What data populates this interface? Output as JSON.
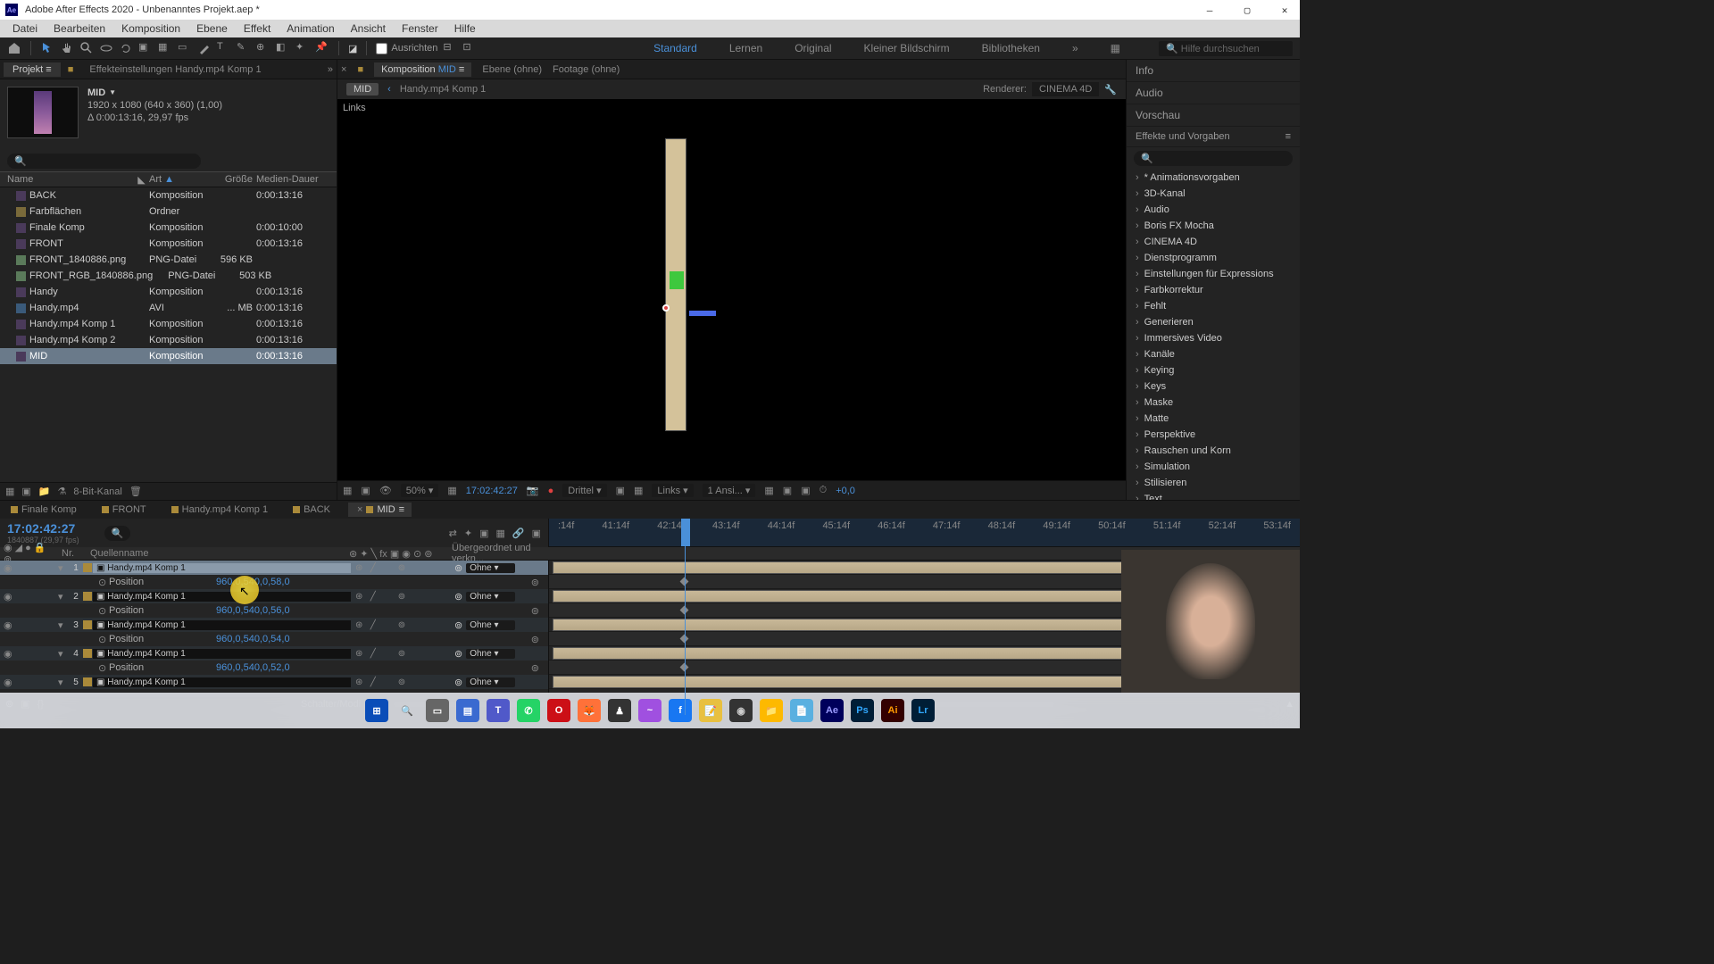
{
  "titlebar": {
    "app": "Adobe After Effects 2020",
    "file": "Unbenanntes Projekt.aep *"
  },
  "menu": [
    "Datei",
    "Bearbeiten",
    "Komposition",
    "Ebene",
    "Effekt",
    "Animation",
    "Ansicht",
    "Fenster",
    "Hilfe"
  ],
  "toolbar": {
    "ausrichten": "Ausrichten"
  },
  "workspaces": {
    "items": [
      "Standard",
      "Lernen",
      "Original",
      "Kleiner Bildschirm",
      "Bibliotheken"
    ],
    "active": "Standard",
    "search_ph": "Hilfe durchsuchen"
  },
  "project": {
    "tabs": {
      "projekt": "Projekt",
      "effekteinstellungen": "Effekteinstellungen Handy.mp4 Komp 1"
    },
    "preview": {
      "name": "MID",
      "dims": "1920 x 1080 (640 x 360) (1,00)",
      "dur": "Δ 0:00:13:16, 29,97 fps"
    },
    "headers": {
      "name": "Name",
      "art": "Art",
      "size": "Größe",
      "dur": "Medien-Dauer"
    },
    "items": [
      {
        "name": "BACK",
        "icon": "comp",
        "dot": "y",
        "art": "Komposition",
        "size": "",
        "dur": "0:00:13:16"
      },
      {
        "name": "Farbflächen",
        "icon": "folder",
        "dot": "n",
        "art": "Ordner",
        "size": "",
        "dur": ""
      },
      {
        "name": "Finale Komp",
        "icon": "comp",
        "dot": "y",
        "art": "Komposition",
        "size": "",
        "dur": "0:00:10:00"
      },
      {
        "name": "FRONT",
        "icon": "comp",
        "dot": "y",
        "art": "Komposition",
        "size": "",
        "dur": "0:00:13:16"
      },
      {
        "name": "FRONT_1840886.png",
        "icon": "png",
        "dot": "y",
        "art": "PNG-Datei",
        "size": "596 KB",
        "dur": ""
      },
      {
        "name": "FRONT_RGB_1840886.png",
        "icon": "png",
        "dot": "y",
        "art": "PNG-Datei",
        "size": "503 KB",
        "dur": ""
      },
      {
        "name": "Handy",
        "icon": "comp",
        "dot": "y",
        "art": "Komposition",
        "size": "",
        "dur": "0:00:13:16"
      },
      {
        "name": "Handy.mp4",
        "icon": "avi",
        "dot": "n",
        "art": "AVI",
        "size": "... MB",
        "dur": "0:00:13:16"
      },
      {
        "name": "Handy.mp4 Komp 1",
        "icon": "comp",
        "dot": "y",
        "art": "Komposition",
        "size": "",
        "dur": "0:00:13:16"
      },
      {
        "name": "Handy.mp4 Komp 2",
        "icon": "comp",
        "dot": "y",
        "art": "Komposition",
        "size": "",
        "dur": "0:00:13:16"
      },
      {
        "name": "MID",
        "icon": "comp",
        "dot": "y",
        "art": "Komposition",
        "size": "",
        "dur": "0:00:13:16",
        "sel": true
      }
    ],
    "footer_bpc": "8-Bit-Kanal"
  },
  "comp": {
    "tabs": {
      "komp_prefix": "Komposition",
      "komp": "MID",
      "ebene": "Ebene (ohne)",
      "footage": "Footage (ohne)"
    },
    "crumb": {
      "active": "MID",
      "back_icon": "‹",
      "parent": "Handy.mp4 Komp 1",
      "renderer_lbl": "Renderer:",
      "renderer_val": "CINEMA 4D"
    },
    "viewer_label": "Links",
    "footer": {
      "zoom": "50%",
      "tc": "17:02:42:27",
      "res": "Drittel",
      "view": "Links",
      "views": "1 Ansi...",
      "exposure": "+0,0"
    }
  },
  "right": {
    "sections": [
      "Info",
      "Audio",
      "Vorschau"
    ],
    "effects_title": "Effekte und Vorgaben",
    "categories": [
      "* Animationsvorgaben",
      "3D-Kanal",
      "Audio",
      "Boris FX Mocha",
      "CINEMA 4D",
      "Dienstprogramm",
      "Einstellungen für Expressions",
      "Farbkorrektur",
      "Fehlt",
      "Generieren",
      "Immersives Video",
      "Kanäle",
      "Keying",
      "Keys",
      "Maske",
      "Matte",
      "Perspektive",
      "Rauschen und Korn",
      "Simulation",
      "Stilisieren",
      "Text"
    ]
  },
  "timeline": {
    "tabs": [
      "Finale Komp",
      "FRONT",
      "Handy.mp4 Komp 1",
      "BACK",
      "MID"
    ],
    "active_tab": "MID",
    "tc": "17:02:42:27",
    "tc_sub": "1840887 (29,97 fps)",
    "cols": {
      "nr": "Nr.",
      "src": "Quellenname",
      "parent": "Übergeordnet und verkn..."
    },
    "ruler": [
      ":14f",
      "41:14f",
      "42:14f",
      "43:14f",
      "44:14f",
      "45:14f",
      "46:14f",
      "47:14f",
      "48:14f",
      "49:14f",
      "50:14f",
      "51:14f",
      "52:14f",
      "53:14f"
    ],
    "layers": [
      {
        "nr": "1",
        "name": "Handy.mp4 Komp 1",
        "parent": "Ohne",
        "prop": "Position",
        "val": "960,0,540,0,58,0",
        "sel": true
      },
      {
        "nr": "2",
        "name": "Handy.mp4 Komp 1",
        "parent": "Ohne",
        "prop": "Position",
        "val": "960,0,540,0,56,0"
      },
      {
        "nr": "3",
        "name": "Handy.mp4 Komp 1",
        "parent": "Ohne",
        "prop": "Position",
        "val": "960,0,540,0,54,0"
      },
      {
        "nr": "4",
        "name": "Handy.mp4 Komp 1",
        "parent": "Ohne",
        "prop": "Position",
        "val": "960,0,540,0,52,0"
      },
      {
        "nr": "5",
        "name": "Handy.mp4 Komp 1",
        "parent": "Ohne"
      }
    ],
    "footer": "Schalter/Modi"
  },
  "taskbar": {
    "icons": [
      {
        "name": "windows-start",
        "bg": "#0a4db8",
        "txt": "⊞",
        "c": "#fff"
      },
      {
        "name": "search",
        "bg": "transparent",
        "txt": "🔍",
        "c": "#333"
      },
      {
        "name": "task-view",
        "bg": "#666",
        "txt": "▭",
        "c": "#fff"
      },
      {
        "name": "explorer",
        "bg": "#3a6ad0",
        "txt": "▤",
        "c": "#fff"
      },
      {
        "name": "teams",
        "bg": "#5059c9",
        "txt": "T",
        "c": "#fff"
      },
      {
        "name": "whatsapp",
        "bg": "#25d366",
        "txt": "✆",
        "c": "#fff"
      },
      {
        "name": "opera",
        "bg": "#cc0f16",
        "txt": "O",
        "c": "#fff"
      },
      {
        "name": "firefox",
        "bg": "#ff7139",
        "txt": "🦊",
        "c": "#fff"
      },
      {
        "name": "app1",
        "bg": "#333",
        "txt": "♟",
        "c": "#fff"
      },
      {
        "name": "messenger",
        "bg": "#a050e0",
        "txt": "~",
        "c": "#fff"
      },
      {
        "name": "facebook",
        "bg": "#1877f2",
        "txt": "f",
        "c": "#fff"
      },
      {
        "name": "notes",
        "bg": "#e8c040",
        "txt": "📝",
        "c": "#333"
      },
      {
        "name": "obs",
        "bg": "#333",
        "txt": "◉",
        "c": "#ccc"
      },
      {
        "name": "files",
        "bg": "#fdb900",
        "txt": "📁",
        "c": "#333"
      },
      {
        "name": "notepad",
        "bg": "#5ab0e0",
        "txt": "📄",
        "c": "#fff"
      },
      {
        "name": "aftereffects",
        "bg": "#00005b",
        "txt": "Ae",
        "c": "#9999ff"
      },
      {
        "name": "photoshop",
        "bg": "#001e36",
        "txt": "Ps",
        "c": "#31a8ff"
      },
      {
        "name": "illustrator",
        "bg": "#330000",
        "txt": "Ai",
        "c": "#ff9a00"
      },
      {
        "name": "lightroom",
        "bg": "#001e36",
        "txt": "Lr",
        "c": "#31a8ff"
      }
    ]
  }
}
